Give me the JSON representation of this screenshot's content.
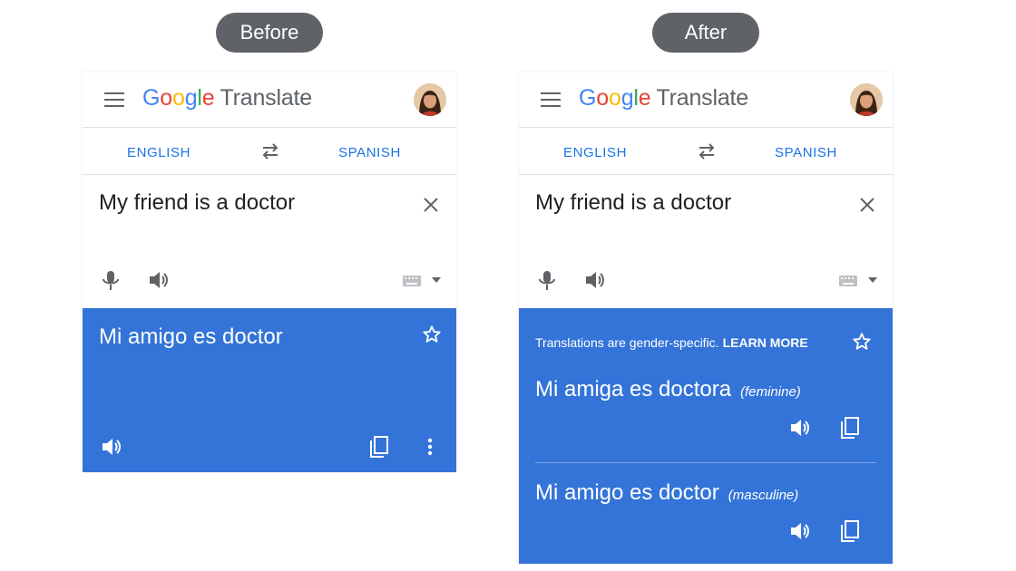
{
  "labels": {
    "before": "Before",
    "after": "After"
  },
  "app": {
    "logo": {
      "letters": [
        "G",
        "o",
        "o",
        "g",
        "l",
        "e"
      ],
      "product": "Translate"
    }
  },
  "languages": {
    "source": "ENGLISH",
    "target": "SPANISH"
  },
  "input": {
    "text": "My friend is a doctor"
  },
  "before": {
    "translation": "Mi amigo es doctor"
  },
  "after": {
    "notice": "Translations are gender-specific.",
    "learn_more": "LEARN MORE",
    "translations": [
      {
        "text": "Mi amiga es doctora",
        "gender": "(feminine)"
      },
      {
        "text": "Mi amigo es doctor",
        "gender": "(masculine)"
      }
    ]
  },
  "colors": {
    "accent": "#1a73e8",
    "result_bg": "#3474d8",
    "pill_bg": "#5f6368",
    "icon_gray": "#5f6368"
  },
  "icons": [
    "menu-icon",
    "avatar",
    "swap-icon",
    "close-icon",
    "mic-icon",
    "speaker-icon",
    "keyboard-icon",
    "caret-down-icon",
    "star-icon",
    "copy-icon",
    "more-vert-icon"
  ]
}
